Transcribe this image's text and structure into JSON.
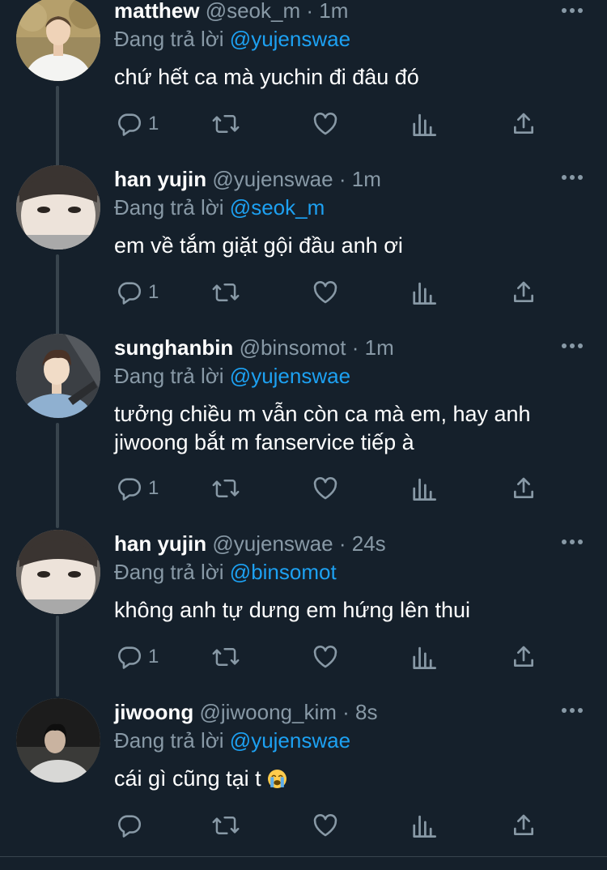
{
  "theme": {
    "background": "#15202b",
    "text": "#ffffff",
    "muted": "#8899a6",
    "link": "#1da1f2",
    "thread_line": "#38444d"
  },
  "replying_label": "Đang trả lời",
  "tweets": [
    {
      "name": "matthew",
      "handle": "@seok_m",
      "separator": "·",
      "time": "1m",
      "reply_to": "@yujenswae",
      "text": "chứ hết ca mà yuchin đi đâu đó",
      "reply_count": "1",
      "avatar_icon": "person-white-shirt-avatar"
    },
    {
      "name": "han yujin",
      "handle": "@yujenswae",
      "separator": "·",
      "time": "1m",
      "reply_to": "@seok_m",
      "text": "em về tắm giặt gội đầu anh ơi",
      "reply_count": "1",
      "avatar_icon": "person-closeup-avatar"
    },
    {
      "name": "sunghanbin",
      "handle": "@binsomot",
      "separator": "·",
      "time": "1m",
      "reply_to": "@yujenswae",
      "text": "tưởng chiều m vẫn còn ca mà em, hay anh jiwoong bắt m fanservice tiếp à",
      "reply_count": "1",
      "avatar_icon": "person-car-selfie-avatar"
    },
    {
      "name": "han yujin",
      "handle": "@yujenswae",
      "separator": "·",
      "time": "24s",
      "reply_to": "@binsomot",
      "text": "không anh tự dưng em hứng lên thui",
      "reply_count": "1",
      "avatar_icon": "person-closeup-avatar"
    },
    {
      "name": "jiwoong",
      "handle": "@jiwoong_kim",
      "separator": "·",
      "time": "8s",
      "reply_to": "@yujenswae",
      "text": "cái gì cũng tại t",
      "reply_count": "",
      "avatar_icon": "person-dark-avatar",
      "trailing_emoji": "loudly-crying-face-emoji"
    }
  ]
}
